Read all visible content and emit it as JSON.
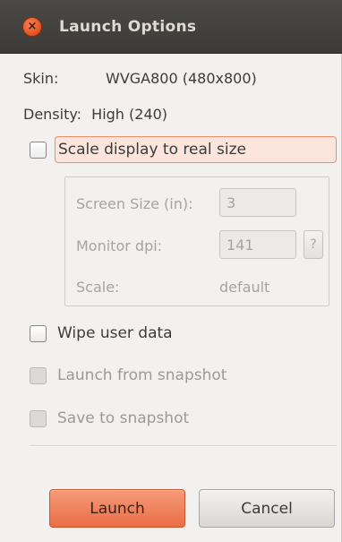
{
  "window": {
    "title": "Launch Options",
    "close_glyph": "×"
  },
  "info": {
    "skin_label": "Skin:",
    "skin_value": "WVGA800 (480x800)",
    "density_label": "Density:",
    "density_value": "High (240)"
  },
  "options": {
    "scale_display": {
      "label": "Scale display to real size",
      "checked": false
    },
    "wipe_user_data": {
      "label": "Wipe user data",
      "checked": false
    },
    "launch_from_snapshot": {
      "label": "Launch from snapshot",
      "checked": false,
      "disabled": true
    },
    "save_to_snapshot": {
      "label": "Save to snapshot",
      "checked": false,
      "disabled": true
    }
  },
  "scale_group": {
    "screen_size_label": "Screen Size (in):",
    "screen_size_value": "3",
    "monitor_dpi_label": "Monitor dpi:",
    "monitor_dpi_value": "141",
    "help_label": "?",
    "scale_label": "Scale:",
    "scale_value": "default"
  },
  "buttons": {
    "launch": "Launch",
    "cancel": "Cancel"
  },
  "colors": {
    "accent": "#ea6e45",
    "titlebar": "#3c3b37",
    "highlight": "#fbe5dc"
  }
}
